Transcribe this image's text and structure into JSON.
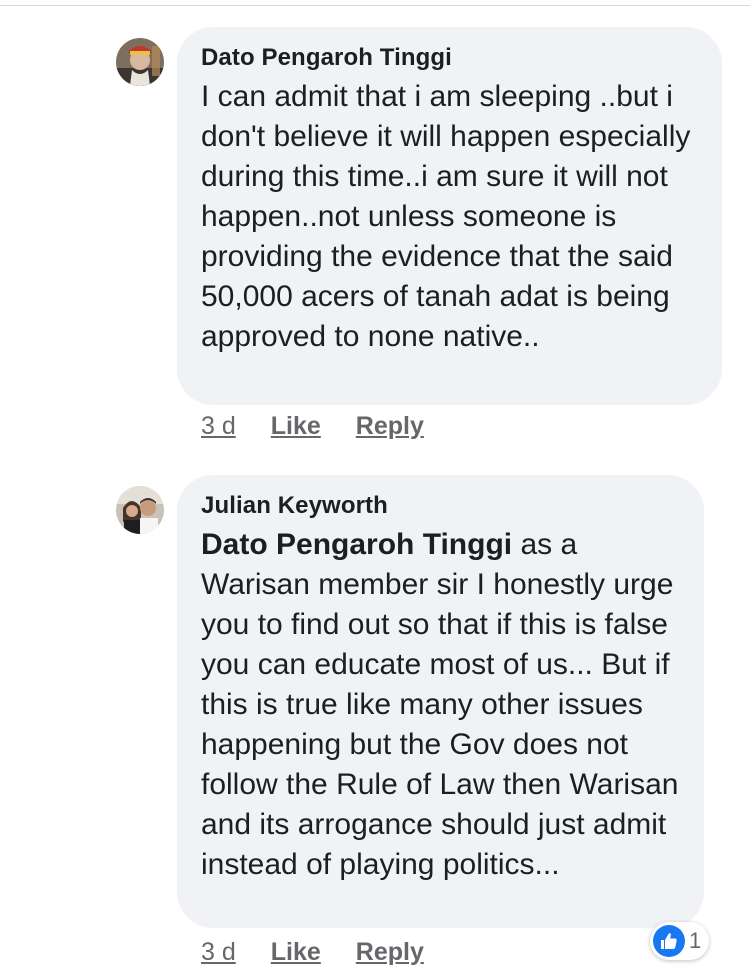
{
  "comments": [
    {
      "author": "Dato Pengaroh Tinggi",
      "text": "I can admit that i am sleeping ..but i don't believe it will happen especially during this time..i am sure it will not happen..not unless someone is providing the evidence that the said 50,000 acers of tanah adat is being approved to none native..",
      "time": "3 d",
      "like_label": "Like",
      "reply_label": "Reply",
      "avatar_icon": "profile-photo"
    },
    {
      "author": "Julian Keyworth",
      "mention": "Dato Pengaroh Tinggi",
      "text": " as a Warisan member sir I honestly urge you to find out so that if this is false you can educate most of us... But if this is true like many other issues happening but the Gov does not follow the Rule of Law then Warisan and its arrogance should just admit instead of playing politics...",
      "time": "3 d",
      "like_label": "Like",
      "reply_label": "Reply",
      "avatar_icon": "profile-photo",
      "reaction": {
        "icon": "thumbs-up-icon",
        "count": "1",
        "color": "#1877f2"
      }
    }
  ],
  "theme": {
    "bubble_bg": "#f0f2f5",
    "text_color": "#1c1e21",
    "meta_color": "#65676b"
  }
}
